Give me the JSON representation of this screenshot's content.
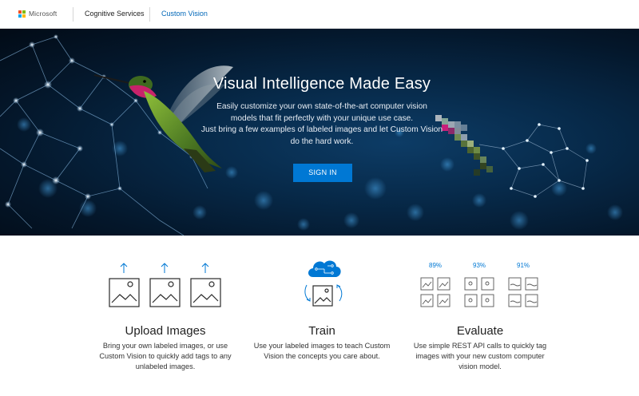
{
  "header": {
    "brand": "Microsoft",
    "nav": [
      {
        "label": "Cognitive Services"
      },
      {
        "label": "Custom Vision"
      }
    ]
  },
  "hero": {
    "title": "Visual Intelligence Made Easy",
    "subtitle_lines": [
      "Easily customize your own state-of-the-art computer vision",
      "models that fit perfectly with your unique use case.",
      "Just bring a few examples of labeled images and let Custom Vision",
      "do the hard work."
    ],
    "cta_label": "SIGN IN"
  },
  "features": [
    {
      "title": "Upload Images",
      "description_lines": [
        "Bring your own labeled images, or use",
        "Custom Vision to quickly add tags to any",
        "unlabeled images."
      ]
    },
    {
      "title": "Train",
      "description_lines": [
        "Use your labeled images to teach Custom",
        "Vision the concepts you care about."
      ]
    },
    {
      "title": "Evaluate",
      "description_lines": [
        "Use simple REST API calls to quickly tag",
        "images with your new custom computer",
        "vision model."
      ],
      "metrics": [
        "89%",
        "93%",
        "91%"
      ]
    }
  ],
  "icons": {
    "logo": "microsoft-logo-icon",
    "upload": "upload-arrow-icon",
    "image": "image-placeholder-icon",
    "train": "cloud-brain-icon",
    "refresh": "sync-arrows-icon"
  },
  "colors": {
    "accent": "#0078d4",
    "link": "#0067b8",
    "hero_bg": "#04172b",
    "ms_red": "#f25022",
    "ms_green": "#7fba00",
    "ms_blue": "#00a4ef",
    "ms_yellow": "#ffb900"
  }
}
